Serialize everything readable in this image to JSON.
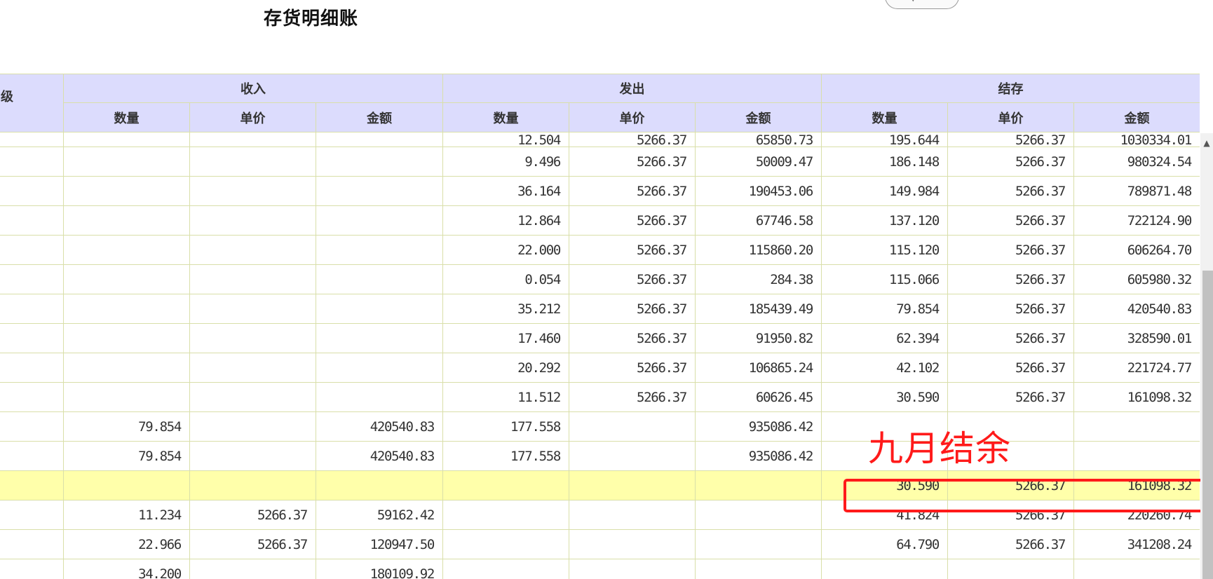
{
  "title": "存货明细账",
  "icons": {
    "toolbar": [
      "chevron-down-icon",
      "grid-icon"
    ],
    "scroll_up": "▲"
  },
  "colors": {
    "header_bg": "#dcdcfd",
    "grid_line": "#d9dfa9",
    "highlight_row": "#ffffaa",
    "annotation": "#ff1a1a"
  },
  "table": {
    "group_headers": {
      "level": "级",
      "income": "收入",
      "issue": "发出",
      "balance": "结存"
    },
    "sub_headers": [
      "数量",
      "单价",
      "金额",
      "数量",
      "单价",
      "金额",
      "数量",
      "单价",
      "金额"
    ],
    "rows": [
      [
        "",
        "",
        "",
        "12.504",
        "5266.37",
        "65850.73",
        "195.644",
        "5266.37",
        "1030334.01"
      ],
      [
        "",
        "",
        "",
        "9.496",
        "5266.37",
        "50009.47",
        "186.148",
        "5266.37",
        "980324.54"
      ],
      [
        "",
        "",
        "",
        "36.164",
        "5266.37",
        "190453.06",
        "149.984",
        "5266.37",
        "789871.48"
      ],
      [
        "",
        "",
        "",
        "12.864",
        "5266.37",
        "67746.58",
        "137.120",
        "5266.37",
        "722124.90"
      ],
      [
        "",
        "",
        "",
        "22.000",
        "5266.37",
        "115860.20",
        "115.120",
        "5266.37",
        "606264.70"
      ],
      [
        "",
        "",
        "",
        "0.054",
        "5266.37",
        "284.38",
        "115.066",
        "5266.37",
        "605980.32"
      ],
      [
        "",
        "",
        "",
        "35.212",
        "5266.37",
        "185439.49",
        "79.854",
        "5266.37",
        "420540.83"
      ],
      [
        "",
        "",
        "",
        "17.460",
        "5266.37",
        "91950.82",
        "62.394",
        "5266.37",
        "328590.01"
      ],
      [
        "",
        "",
        "",
        "20.292",
        "5266.37",
        "106865.24",
        "42.102",
        "5266.37",
        "221724.77"
      ],
      [
        "",
        "",
        "",
        "11.512",
        "5266.37",
        "60626.45",
        "30.590",
        "5266.37",
        "161098.32"
      ],
      [
        "79.854",
        "",
        "420540.83",
        "177.558",
        "",
        "935086.42",
        "",
        "",
        ""
      ],
      [
        "79.854",
        "",
        "420540.83",
        "177.558",
        "",
        "935086.42",
        "",
        "",
        ""
      ],
      [
        "",
        "",
        "",
        "",
        "",
        "",
        "30.590",
        "5266.37",
        "161098.32"
      ],
      [
        "11.234",
        "5266.37",
        "59162.42",
        "",
        "",
        "",
        "41.824",
        "5266.37",
        "220260.74"
      ],
      [
        "22.966",
        "5266.37",
        "120947.50",
        "",
        "",
        "",
        "64.790",
        "5266.37",
        "341208.24"
      ],
      [
        "34.200",
        "",
        "180109.92",
        "",
        "",
        "",
        "",
        "",
        ""
      ]
    ]
  },
  "annotation": {
    "label": "九月结余"
  }
}
